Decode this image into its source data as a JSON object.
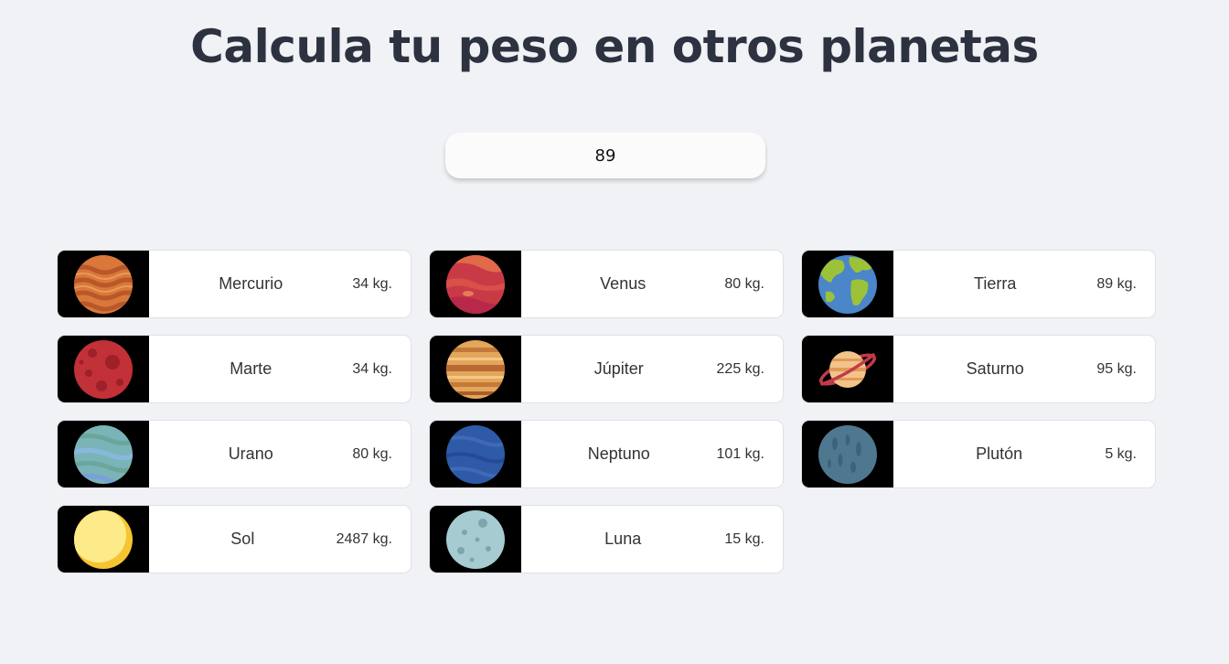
{
  "header": {
    "title": "Calcula tu peso en otros planetas"
  },
  "weight_input": {
    "value": "89"
  },
  "planets": [
    {
      "name": "Mercurio",
      "weight": "34 kg.",
      "icon": "mercury-icon"
    },
    {
      "name": "Venus",
      "weight": "80 kg.",
      "icon": "venus-icon"
    },
    {
      "name": "Tierra",
      "weight": "89 kg.",
      "icon": "earth-icon"
    },
    {
      "name": "Marte",
      "weight": "34 kg.",
      "icon": "mars-icon"
    },
    {
      "name": "Júpiter",
      "weight": "225 kg.",
      "icon": "jupiter-icon"
    },
    {
      "name": "Saturno",
      "weight": "95 kg.",
      "icon": "saturn-icon"
    },
    {
      "name": "Urano",
      "weight": "80 kg.",
      "icon": "uranus-icon"
    },
    {
      "name": "Neptuno",
      "weight": "101 kg.",
      "icon": "neptune-icon"
    },
    {
      "name": "Plutón",
      "weight": "5 kg.",
      "icon": "pluto-icon"
    },
    {
      "name": "Sol",
      "weight": "2487 kg.",
      "icon": "sun-icon"
    },
    {
      "name": "Luna",
      "weight": "15 kg.",
      "icon": "moon-icon"
    }
  ],
  "colors": {
    "background": "#f1f2f6",
    "title": "#2d3240",
    "card": "#ffffff",
    "image_bg": "#000000"
  }
}
